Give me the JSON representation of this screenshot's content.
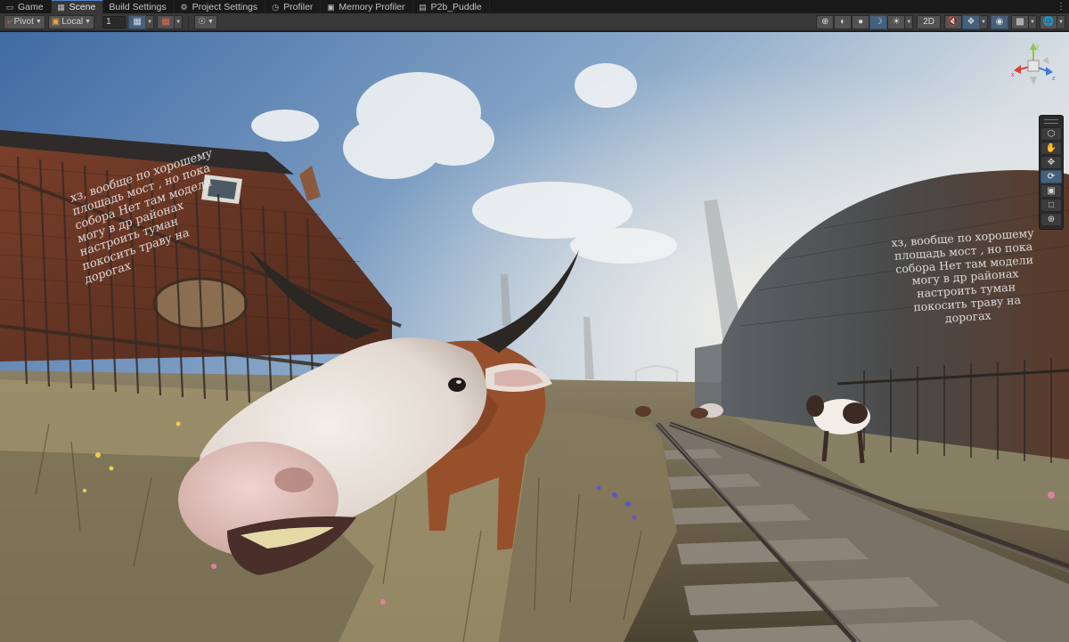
{
  "tabs": [
    {
      "label": "Game",
      "icon": "game-controller-icon",
      "active": false
    },
    {
      "label": "Scene",
      "icon": "scene-grid-icon",
      "active": true
    },
    {
      "label": "Build Settings",
      "icon": "",
      "active": false
    },
    {
      "label": "Project Settings",
      "icon": "gear-icon",
      "active": false
    },
    {
      "label": "Profiler",
      "icon": "profiler-icon",
      "active": false
    },
    {
      "label": "Memory Profiler",
      "icon": "memory-chip-icon",
      "active": false
    },
    {
      "label": "P2b_Puddle",
      "icon": "document-icon",
      "active": false
    }
  ],
  "toolbar": {
    "pivot_label": "Pivot",
    "space_label": "Local",
    "grid_value": "1",
    "view_2d_label": "2D"
  },
  "scene": {
    "wall_text_left": "хз, вообще по хорошему\nплощадь мост , но пока\nсобора Нет там модели\nмогу в др районах\nнастроить туман\nпокосить траву на\nдорогах",
    "wall_text_right": "хз, вообще по хорошему\nплощадь мост , но пока\nсобора Нет там модели\nмогу в др районах\nнастроить туман\nпокосить траву на\nдорогах"
  },
  "gizmo": {
    "x_label": "x",
    "y_label": "y",
    "z_label": "z"
  },
  "tools": [
    {
      "name": "view-tool",
      "icon": "cube-icon",
      "active": false
    },
    {
      "name": "hand-tool",
      "icon": "hand-icon",
      "active": false
    },
    {
      "name": "move-tool",
      "icon": "move-arrows-icon",
      "active": false
    },
    {
      "name": "rotate-tool",
      "icon": "rotate-icon",
      "active": true
    },
    {
      "name": "scale-tool",
      "icon": "scale-icon",
      "active": false
    },
    {
      "name": "rect-tool",
      "icon": "rect-icon",
      "active": false
    },
    {
      "name": "transform-tool",
      "icon": "transform-icon",
      "active": false
    }
  ],
  "colors": {
    "toolbar_bg": "#383838",
    "tab_active_bg": "#383838",
    "accent_active": "#46607c",
    "gizmo_x": "#d8413a",
    "gizmo_y": "#8fc745",
    "gizmo_z": "#3e7ad0"
  }
}
